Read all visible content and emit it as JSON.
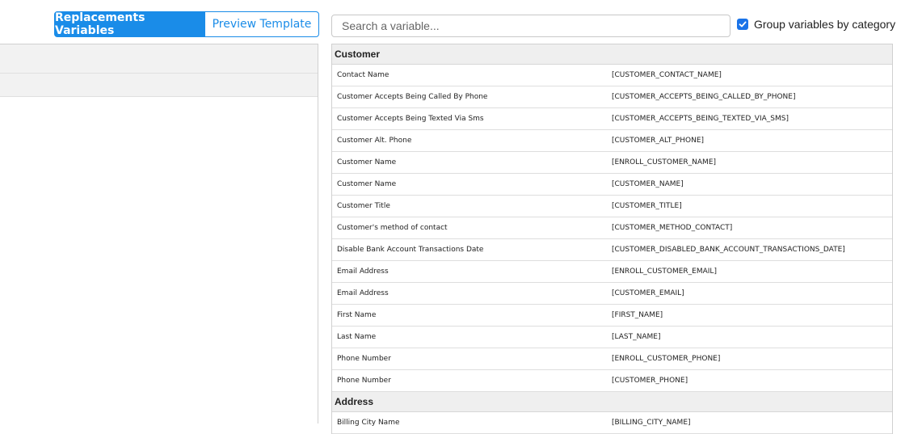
{
  "tabs": {
    "replacements_label": "Replacements Variables",
    "preview_label": "Preview Template"
  },
  "search": {
    "placeholder": "Search a variable..."
  },
  "group_toggle": {
    "label": "Group variables by category",
    "checked": true
  },
  "categories": [
    {
      "name": "Customer",
      "rows": [
        {
          "label": "Contact Name",
          "code": "[CUSTOMER_CONTACT_NAME]"
        },
        {
          "label": "Customer Accepts Being Called By Phone",
          "code": "[CUSTOMER_ACCEPTS_BEING_CALLED_BY_PHONE]"
        },
        {
          "label": "Customer Accepts Being Texted Via Sms",
          "code": "[CUSTOMER_ACCEPTS_BEING_TEXTED_VIA_SMS]"
        },
        {
          "label": "Customer Alt. Phone",
          "code": "[CUSTOMER_ALT_PHONE]"
        },
        {
          "label": "Customer Name",
          "code": "[ENROLL_CUSTOMER_NAME]"
        },
        {
          "label": "Customer Name",
          "code": "[CUSTOMER_NAME]"
        },
        {
          "label": "Customer Title",
          "code": "[CUSTOMER_TITLE]"
        },
        {
          "label": "Customer's method of contact",
          "code": "[CUSTOMER_METHOD_CONTACT]"
        },
        {
          "label": "Disable Bank Account Transactions Date",
          "code": "[CUSTOMER_DISABLED_BANK_ACCOUNT_TRANSACTIONS_DATE]"
        },
        {
          "label": "Email Address",
          "code": "[ENROLL_CUSTOMER_EMAIL]"
        },
        {
          "label": "Email Address",
          "code": "[CUSTOMER_EMAIL]"
        },
        {
          "label": "First Name",
          "code": "[FIRST_NAME]"
        },
        {
          "label": "Last Name",
          "code": "[LAST_NAME]"
        },
        {
          "label": "Phone Number",
          "code": "[ENROLL_CUSTOMER_PHONE]"
        },
        {
          "label": "Phone Number",
          "code": "[CUSTOMER_PHONE]"
        }
      ]
    },
    {
      "name": "Address",
      "rows": [
        {
          "label": "Billing City Name",
          "code": "[BILLING_CITY_NAME]"
        }
      ]
    }
  ],
  "colors": {
    "accent": "#1a8ce8",
    "checkbox": "#1a73e8"
  }
}
